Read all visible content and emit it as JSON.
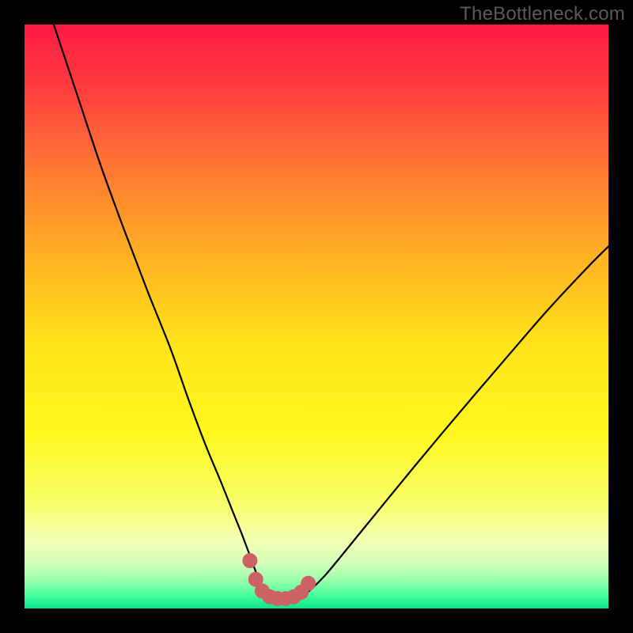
{
  "watermark": "TheBottleneck.com",
  "colors": {
    "frame": "#000000",
    "curve": "#000000",
    "marker_fill": "#cc6263",
    "marker_stroke": "#cc6263",
    "gradient_stops": [
      {
        "offset": 0.0,
        "color": "#ff1a44"
      },
      {
        "offset": 0.1,
        "color": "#ff3a3f"
      },
      {
        "offset": 0.25,
        "color": "#ff7a33"
      },
      {
        "offset": 0.4,
        "color": "#ffb222"
      },
      {
        "offset": 0.55,
        "color": "#ffe41a"
      },
      {
        "offset": 0.7,
        "color": "#fff81e"
      },
      {
        "offset": 0.82,
        "color": "#f8ff6a"
      },
      {
        "offset": 0.88,
        "color": "#f2ffb0"
      },
      {
        "offset": 0.92,
        "color": "#d6ffbb"
      },
      {
        "offset": 0.95,
        "color": "#9fffad"
      },
      {
        "offset": 0.975,
        "color": "#4fffa0"
      },
      {
        "offset": 1.0,
        "color": "#08e589"
      }
    ]
  },
  "chart_data": {
    "type": "line",
    "title": "",
    "xlabel": "",
    "ylabel": "",
    "xlim": [
      0,
      100
    ],
    "ylim": [
      0,
      100
    ],
    "grid": false,
    "series": [
      {
        "name": "bottleneck-curve",
        "x": [
          5.0,
          9.0,
          13.0,
          17.0,
          21.0,
          25.0,
          28.0,
          31.0,
          33.5,
          35.5,
          37.3,
          38.8,
          40.0,
          41.2,
          42.5,
          44.0,
          45.8,
          47.5,
          49.2,
          51.5,
          54.5,
          58.0,
          62.0,
          66.5,
          71.5,
          77.0,
          83.0,
          89.5,
          96.5,
          100.0
        ],
        "values": [
          100.0,
          88.0,
          76.0,
          65.0,
          54.5,
          44.5,
          36.0,
          28.0,
          22.0,
          17.0,
          12.5,
          8.5,
          5.3,
          3.2,
          2.0,
          1.5,
          1.5,
          2.1,
          3.4,
          5.7,
          9.3,
          13.6,
          18.5,
          24.0,
          30.0,
          36.5,
          43.5,
          51.0,
          58.5,
          62.0
        ]
      }
    ],
    "markers": {
      "name": "highlight-points",
      "x": [
        38.6,
        39.6,
        40.7,
        42.0,
        43.3,
        44.7,
        46.1,
        47.4,
        48.6
      ],
      "values": [
        8.2,
        5.0,
        3.0,
        2.0,
        1.7,
        1.7,
        2.0,
        2.8,
        4.3
      ]
    }
  }
}
